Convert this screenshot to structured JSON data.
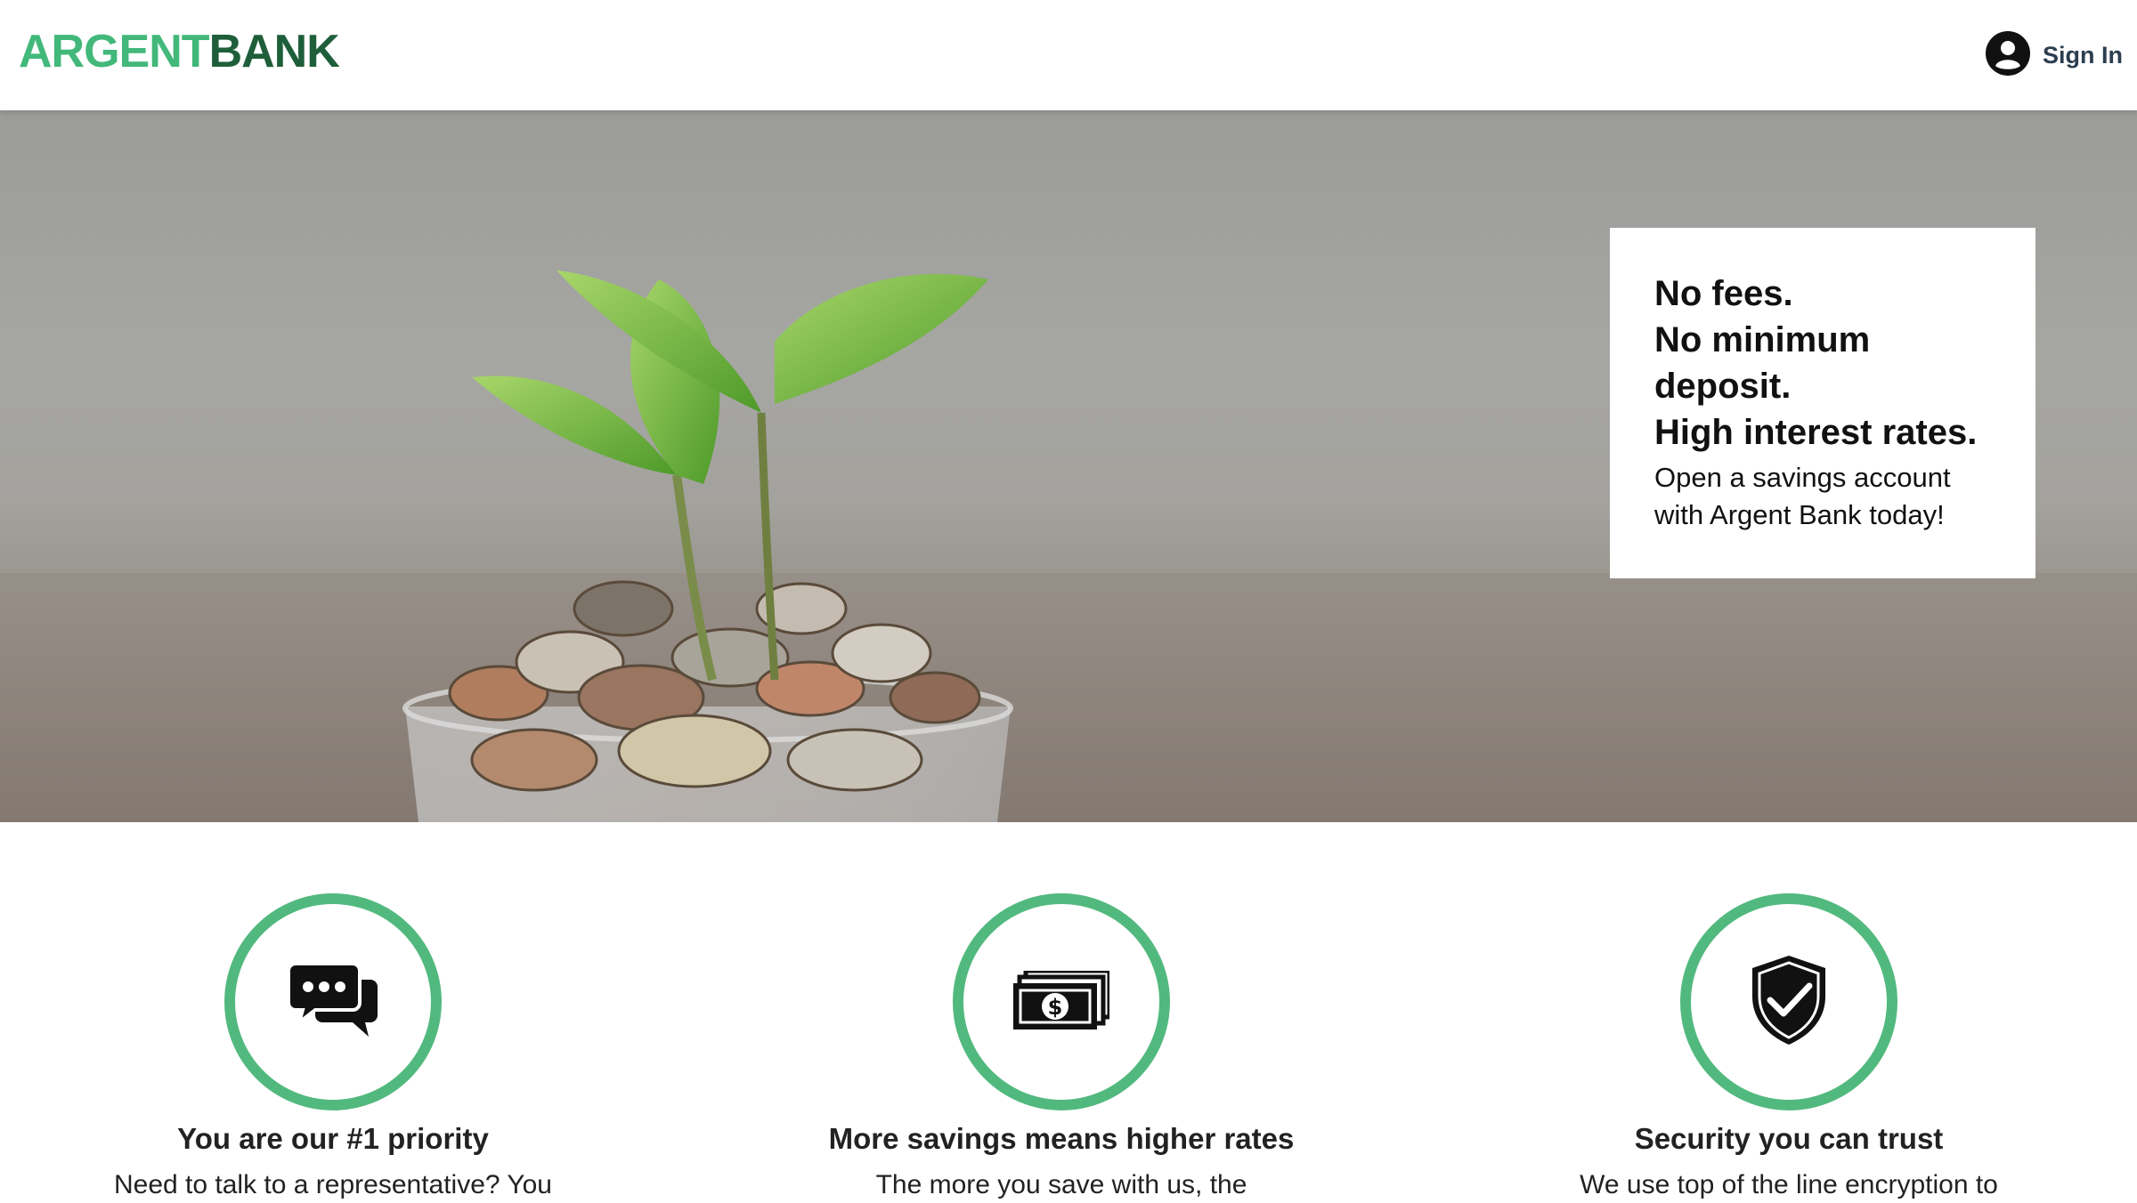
{
  "header": {
    "logo_part1": "ARGENT",
    "logo_part2": "BANK",
    "signin_label": "Sign In",
    "signin_icon": "user-circle-icon"
  },
  "hero": {
    "image_subject": "seedling-in-coins",
    "promo": {
      "subtitles": [
        "No fees.",
        "No minimum deposit.",
        "High interest rates."
      ],
      "text": "Open a savings account with Argent Bank today!"
    }
  },
  "features": [
    {
      "icon": "chat-icon",
      "title": "You are our #1 priority",
      "description": "Need to talk to a representative? You"
    },
    {
      "icon": "money-icon",
      "title": "More savings means higher rates",
      "description": "The more you save with us, the"
    },
    {
      "icon": "security-icon",
      "title": "Security you can trust",
      "description": "We use top of the line encryption to"
    }
  ],
  "colors": {
    "brand_light": "#42b87a",
    "brand_dark": "#1f5e3a",
    "icon_ring": "#52b97e"
  }
}
